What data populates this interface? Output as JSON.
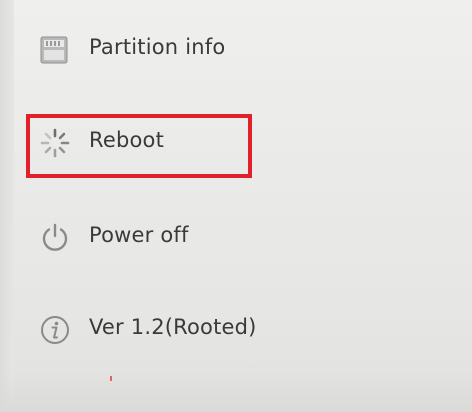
{
  "menu": {
    "items": [
      {
        "id": "partition",
        "label": "Partition info",
        "icon": "sd-card-icon"
      },
      {
        "id": "reboot",
        "label": "Reboot",
        "icon": "reboot-spinner-icon"
      },
      {
        "id": "power",
        "label": "Power off",
        "icon": "power-icon"
      },
      {
        "id": "version",
        "label": "Ver 1.2(Rooted)",
        "icon": "info-icon"
      }
    ]
  },
  "highlight": {
    "target": "reboot",
    "color": "#e2202a"
  },
  "colors": {
    "background": "#ececea",
    "text": "#3a3a3a",
    "icon": "#8a8a8a"
  }
}
